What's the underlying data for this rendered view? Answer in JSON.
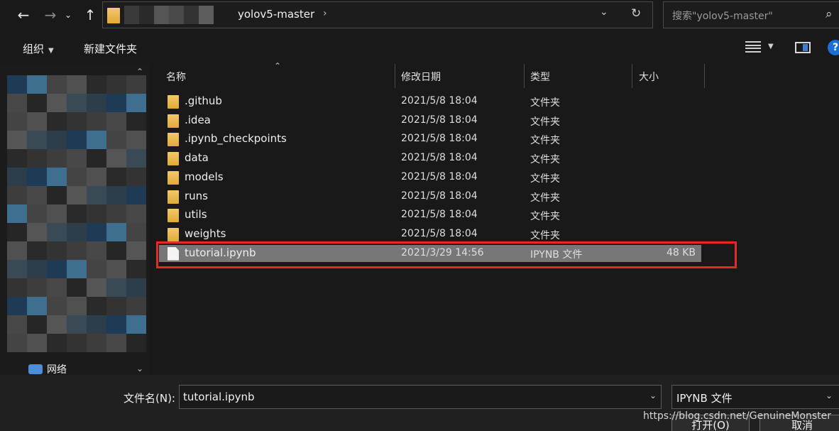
{
  "nav": {
    "back_icon": "arrow-left-icon",
    "forward_icon": "arrow-right-icon",
    "recent_icon": "chevron-down-icon",
    "up_icon": "arrow-up-icon"
  },
  "address": {
    "current_folder": "yolov5-master",
    "separator": "›"
  },
  "search": {
    "placeholder": "搜索\"yolov5-master\""
  },
  "toolbar": {
    "organize_label": "组织",
    "new_folder_label": "新建文件夹"
  },
  "sidebar": {
    "network_label": "网络"
  },
  "columns": {
    "name": "名称",
    "date": "修改日期",
    "type": "类型",
    "size": "大小"
  },
  "files": [
    {
      "name": ".github",
      "date": "2021/5/8 18:04",
      "type": "文件夹",
      "size": "",
      "kind": "folder"
    },
    {
      "name": ".idea",
      "date": "2021/5/8 18:04",
      "type": "文件夹",
      "size": "",
      "kind": "folder"
    },
    {
      "name": ".ipynb_checkpoints",
      "date": "2021/5/8 18:04",
      "type": "文件夹",
      "size": "",
      "kind": "folder"
    },
    {
      "name": "data",
      "date": "2021/5/8 18:04",
      "type": "文件夹",
      "size": "",
      "kind": "folder"
    },
    {
      "name": "models",
      "date": "2021/5/8 18:04",
      "type": "文件夹",
      "size": "",
      "kind": "folder"
    },
    {
      "name": "runs",
      "date": "2021/5/8 18:04",
      "type": "文件夹",
      "size": "",
      "kind": "folder"
    },
    {
      "name": "utils",
      "date": "2021/5/8 18:04",
      "type": "文件夹",
      "size": "",
      "kind": "folder"
    },
    {
      "name": "weights",
      "date": "2021/5/8 18:04",
      "type": "文件夹",
      "size": "",
      "kind": "folder"
    },
    {
      "name": "tutorial.ipynb",
      "date": "2021/3/29 14:56",
      "type": "IPYNB 文件",
      "size": "48 KB",
      "kind": "file"
    }
  ],
  "bottom": {
    "filename_label": "文件名(N):",
    "filename_value": "tutorial.ipynb",
    "filetype_value": "IPYNB 文件",
    "open_button": "打开(O)",
    "cancel_button": "取消"
  },
  "watermark": "https://blog.csdn.net/GenuineMonster",
  "colors": {
    "highlight": "#e02b2b",
    "selection": "#777777",
    "folder": "#e0a93a"
  }
}
